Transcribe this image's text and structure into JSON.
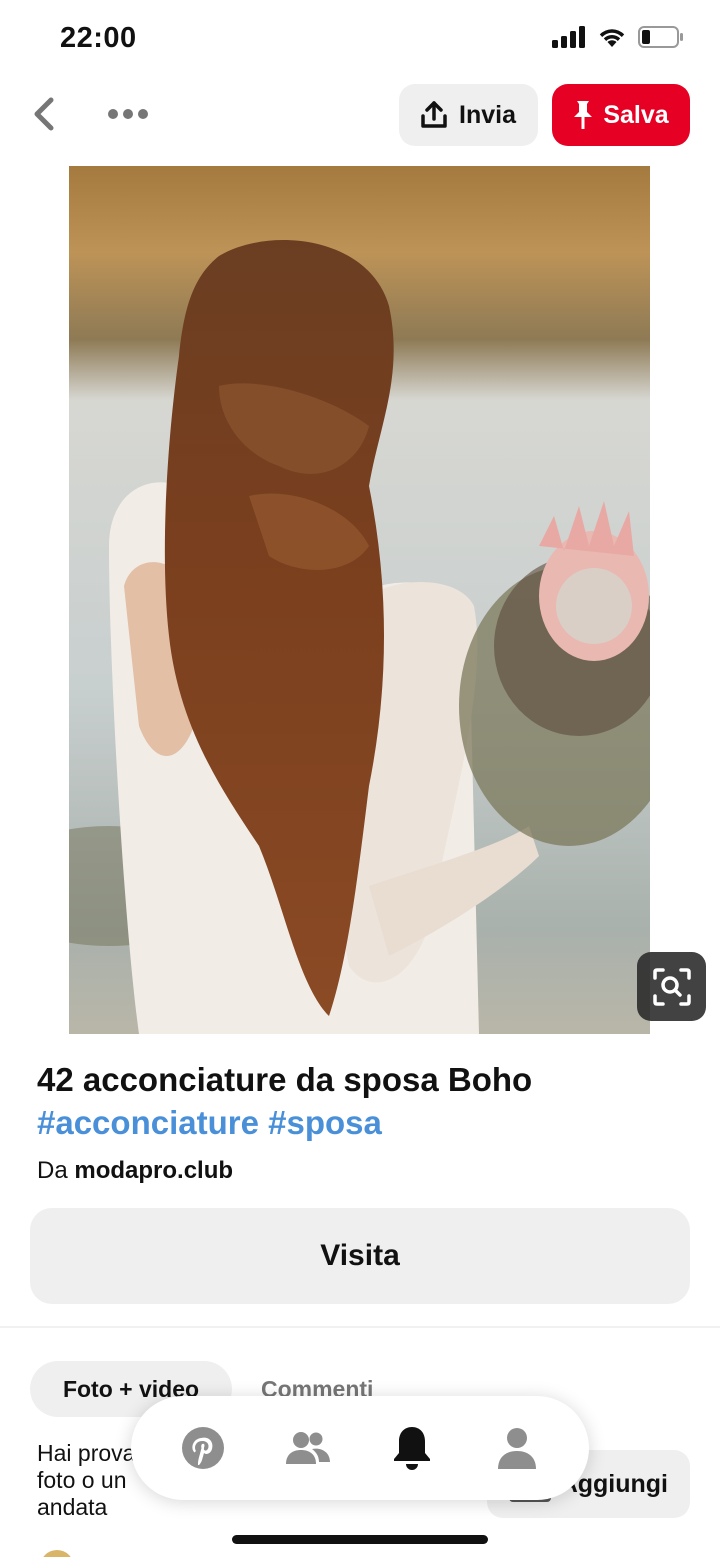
{
  "status_bar": {
    "time": "22:00",
    "icons": [
      "cellular-signal-icon",
      "wifi-icon",
      "battery-icon"
    ]
  },
  "topbar": {
    "back_icon": "chevron-left-icon",
    "more_icon": "more-dots-icon",
    "send_label": "Invia",
    "save_label": "Salva"
  },
  "pin": {
    "image_description": "bride with long braided hair holding protea bouquet",
    "lens_icon": "visual-search-icon",
    "title": "42 acconciature da sposa Boho",
    "hashtags": "#acconciature #sposa",
    "source_prefix": "Da",
    "source_domain": "modapro.club",
    "visit_label": "Visita"
  },
  "tabs": {
    "photos_label": "Foto + video",
    "comments_label": "Commenti"
  },
  "tried": {
    "text": "Hai prova\nfoto o un\nandata",
    "add_label": "Aggiungi"
  },
  "bottom_nav": {
    "items": [
      "pinterest-home-icon",
      "following-icon",
      "notifications-bell-icon",
      "profile-icon"
    ]
  },
  "colors": {
    "brand_red": "#e60023",
    "hashtag_blue": "#4a90d9",
    "button_gray": "#efefef"
  }
}
